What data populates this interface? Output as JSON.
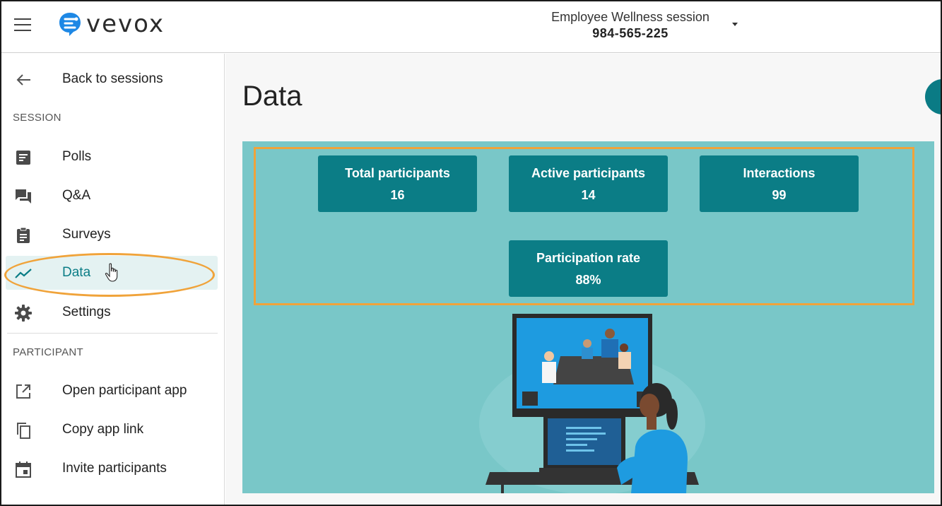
{
  "header": {
    "logo_text": "vevox",
    "session_name": "Employee Wellness session",
    "session_code": "984-565-225"
  },
  "sidebar": {
    "back_label": "Back to sessions",
    "session_section": "SESSION",
    "session_items": [
      {
        "label": "Polls",
        "icon": "poll-icon"
      },
      {
        "label": "Q&A",
        "icon": "qa-icon"
      },
      {
        "label": "Surveys",
        "icon": "survey-icon"
      },
      {
        "label": "Data",
        "icon": "trend-icon",
        "active": true
      },
      {
        "label": "Settings",
        "icon": "gear-icon"
      }
    ],
    "participant_section": "PARTICIPANT",
    "participant_items": [
      {
        "label": "Open participant app",
        "icon": "open-external-icon"
      },
      {
        "label": "Copy app link",
        "icon": "copy-icon"
      },
      {
        "label": "Invite participants",
        "icon": "calendar-icon"
      }
    ]
  },
  "main": {
    "title": "Data",
    "stats": [
      {
        "label": "Total participants",
        "value": "16"
      },
      {
        "label": "Active participants",
        "value": "14"
      },
      {
        "label": "Interactions",
        "value": "99"
      },
      {
        "label": "Participation rate",
        "value": "88%"
      }
    ]
  },
  "colors": {
    "accent": "#0b7d86",
    "panel_bg": "#79c7c8",
    "highlight": "#f0a33a",
    "active_bg": "#e4f2f2"
  }
}
